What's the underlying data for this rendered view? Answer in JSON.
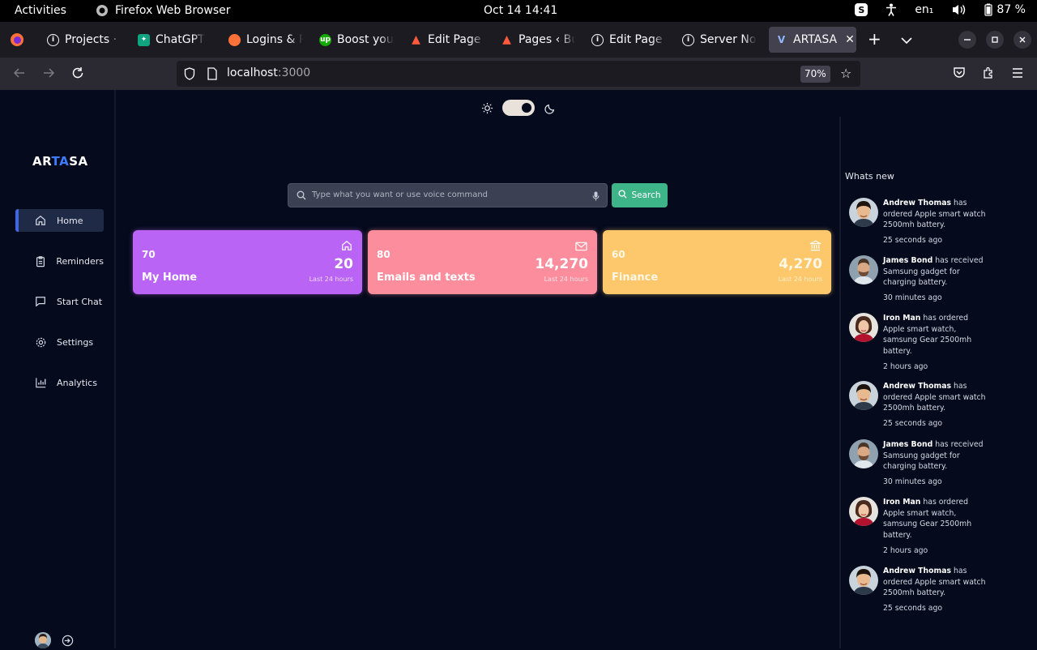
{
  "system_bar": {
    "activities": "Activities",
    "app_name": "Firefox Web Browser",
    "clock": "Oct 14  14:41",
    "language": "en₁",
    "battery": "87 %"
  },
  "tabs": [
    {
      "title": "Projects · D",
      "favicon": "info-icon"
    },
    {
      "title": "ChatGPT",
      "favicon": "chatgpt-icon"
    },
    {
      "title": "Logins & P",
      "favicon": "firefox-icon"
    },
    {
      "title": "Boost your",
      "favicon": "upwork-icon"
    },
    {
      "title": "Edit Page ‹",
      "favicon": "triangle-icon"
    },
    {
      "title": "Pages ‹ Bu",
      "favicon": "triangle-icon"
    },
    {
      "title": "Edit Page ‹",
      "favicon": "info-icon"
    },
    {
      "title": "Server Not",
      "favicon": "info-icon"
    },
    {
      "title": "ARTASA",
      "favicon": "vite-icon",
      "active": true
    }
  ],
  "url": {
    "host": "localhost",
    "port": ":3000",
    "zoom": "70%"
  },
  "theme_toggle": {
    "state": "dark"
  },
  "logo": {
    "part1": "AR",
    "part2": "TA",
    "part3": "SA"
  },
  "sidebar": {
    "items": [
      {
        "label": "Home",
        "icon": "home-icon",
        "active": true
      },
      {
        "label": "Reminders",
        "icon": "clipboard-icon"
      },
      {
        "label": "Start Chat",
        "icon": "chat-icon"
      },
      {
        "label": "Settings",
        "icon": "gear-icon"
      },
      {
        "label": "Analytics",
        "icon": "bar-chart-icon"
      }
    ]
  },
  "search": {
    "placeholder": "Type what you want or use voice command",
    "button": "Search"
  },
  "cards": [
    {
      "count": "70",
      "label": "My Home",
      "value": "20",
      "sub": "Last 24 hours",
      "icon": "home-icon",
      "color": "#b964f4"
    },
    {
      "count": "80",
      "label": "Emails and texts",
      "value": "14,270",
      "sub": "Last 24 hours",
      "icon": "mail-icon",
      "color": "#fb8d9c"
    },
    {
      "count": "60",
      "label": "Finance",
      "value": "4,270",
      "sub": "Last 24 hours",
      "icon": "bank-icon",
      "color": "#fcc86b"
    }
  ],
  "whats_new": {
    "title": "Whats new",
    "items": [
      {
        "name": "Andrew Thomas",
        "text": " has ordered Apple smart watch 2500mh battery.",
        "time": "25 seconds ago",
        "avatar": "asian-man"
      },
      {
        "name": "James Bond",
        "text": " has received Samsung gadget for charging battery.",
        "time": "30 minutes ago",
        "avatar": "man-beard"
      },
      {
        "name": "Iron Man",
        "text": " has ordered Apple smart watch, samsung Gear 2500mh battery.",
        "time": "2 hours ago",
        "avatar": "woman-red"
      },
      {
        "name": "Andrew Thomas",
        "text": " has ordered Apple smart watch 2500mh battery.",
        "time": "25 seconds ago",
        "avatar": "asian-man"
      },
      {
        "name": "James Bond",
        "text": " has received Samsung gadget for charging battery.",
        "time": "30 minutes ago",
        "avatar": "man-beard"
      },
      {
        "name": "Iron Man",
        "text": " has ordered Apple smart watch, samsung Gear 2500mh battery.",
        "time": "2 hours ago",
        "avatar": "woman-red"
      },
      {
        "name": "Andrew Thomas",
        "text": " has ordered Apple smart watch 2500mh battery.",
        "time": "25 seconds ago",
        "avatar": "asian-man"
      }
    ]
  }
}
